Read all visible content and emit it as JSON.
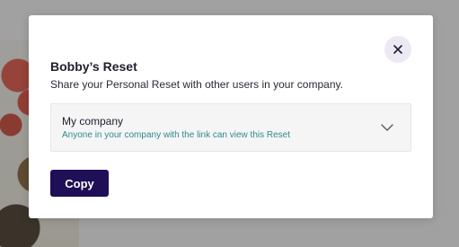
{
  "modal": {
    "title": "Bobby’s Reset",
    "subtitle": "Share your Personal Reset with other users in your company.",
    "close_icon": "close-icon"
  },
  "share_select": {
    "selected_label": "My company",
    "selected_description": "Anyone in your company with the link can view this Reset",
    "icon": "chevron-down-icon"
  },
  "actions": {
    "copy_label": "Copy"
  },
  "colors": {
    "primary": "#1e0f57",
    "accent_text": "#2f8a8c",
    "close_bg": "#ece9f4"
  }
}
